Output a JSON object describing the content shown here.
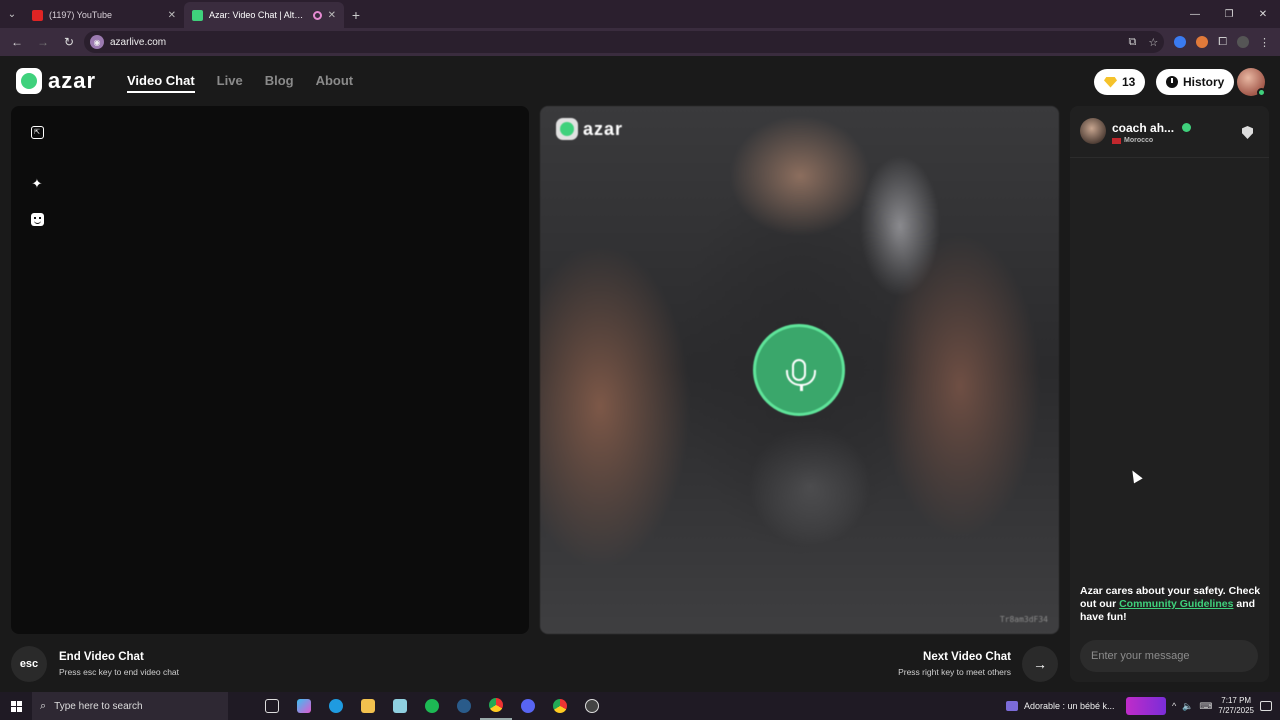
{
  "browser": {
    "tabs": [
      {
        "title": "(1197) YouTube",
        "favicon_color": "#e02424",
        "active": false
      },
      {
        "title": "Azar: Video Chat | Alternative",
        "favicon_color": "#3fd17c",
        "active": true
      }
    ],
    "url": "azarlive.com"
  },
  "site": {
    "logo_text": "azar",
    "nav": [
      {
        "label": "Video Chat",
        "active": true
      },
      {
        "label": "Live",
        "active": false
      },
      {
        "label": "Blog",
        "active": false
      },
      {
        "label": "About",
        "active": false
      }
    ],
    "gems": "13",
    "history_label": "History",
    "accent": "#3fd17c"
  },
  "remote": {
    "logo_text": "azar",
    "user_id": "Tr8am3dF34"
  },
  "chat": {
    "peer_name": "coach ah...",
    "peer_country": "Morocco",
    "safety_prefix": "Azar cares about your safety. Check out our ",
    "safety_link": "Community Guidelines",
    "safety_suffix": " and have fun!",
    "input_placeholder": "Enter your message"
  },
  "hints": {
    "esc_key": "esc",
    "end_title": "End Video Chat",
    "end_sub": "Press esc key to end video chat",
    "next_title": "Next Video Chat",
    "next_sub": "Press right key to meet others",
    "next_key_glyph": "→"
  },
  "taskbar": {
    "search_placeholder": "Type here to search",
    "media_title": "Adorable : un bébé k...",
    "time": "7:17 PM",
    "date": "7/27/2025"
  }
}
